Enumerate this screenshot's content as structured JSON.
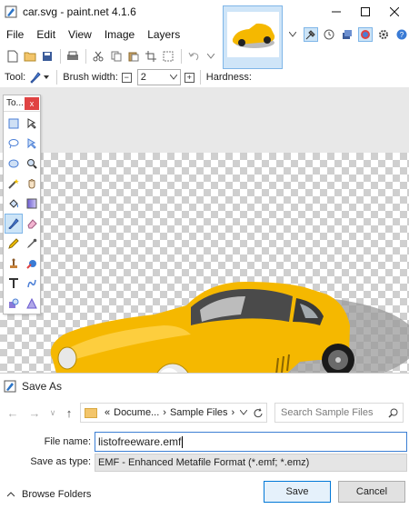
{
  "window": {
    "title": "car.svg - paint.net 4.1.6",
    "controls": [
      "minimize-icon",
      "maximize-icon",
      "close-icon"
    ]
  },
  "menu": [
    "File",
    "Edit",
    "View",
    "Image",
    "Layers"
  ],
  "tool_options": {
    "tool_label": "Tool:",
    "brush_width_label": "Brush width:",
    "brush_width_value": "2",
    "hardness_label": "Hardness:"
  },
  "tools_panel": {
    "title": "To...",
    "close": "x"
  },
  "dialog": {
    "title": "Save As",
    "address": [
      "Docume...",
      "Sample Files"
    ],
    "address_prefix": "«",
    "search_placeholder": "Search Sample Files",
    "file_name_label": "File name:",
    "file_name_value": "listofreeware.emf",
    "save_type_label": "Save as type:",
    "save_type_value": "EMF - Enhanced Metafile Format (*.emf; *.emz)",
    "browse_label": "Browse Folders",
    "save_label": "Save",
    "cancel_label": "Cancel"
  },
  "colors": {
    "car_body": "#f5b800",
    "accent_blue": "#0078d7",
    "tools_close_red": "#e04343"
  }
}
